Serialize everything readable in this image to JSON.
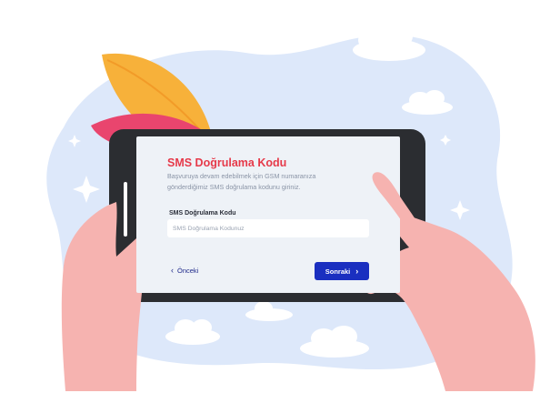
{
  "form": {
    "title": "SMS Doğrulama Kodu",
    "description": "Başvuruya devam edebilmek için GSM numaranıza gönderdiğimiz SMS doğrulama kodunu giriniz.",
    "field_label": "SMS Doğrulama Kodu",
    "field_placeholder": "SMS Doğrulama Kodunuz",
    "field_value": ""
  },
  "navigation": {
    "prev_label": "Önceki",
    "next_label": "Sonraki",
    "prev_icon": "chevron-left-icon",
    "next_icon": "chevron-right-icon"
  },
  "colors": {
    "title": "#e63a4a",
    "primary_button": "#1a2fc0",
    "background_blob": "#dde8fa",
    "tablet_frame": "#2b2d31",
    "skin": "#f6b3b0",
    "leaf_orange": "#f7b13a",
    "leaf_pink": "#e9456e"
  }
}
